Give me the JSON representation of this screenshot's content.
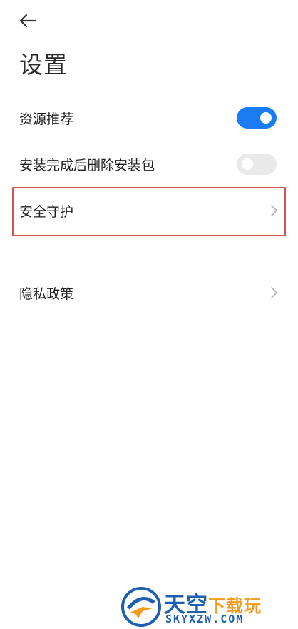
{
  "header": {
    "back_icon": "arrow-left-icon",
    "title": "设置"
  },
  "settings": {
    "resource_recommend": {
      "label": "资源推荐",
      "enabled": true
    },
    "delete_package": {
      "label": "安装完成后删除安装包",
      "enabled": false
    },
    "security": {
      "label": "安全守护",
      "icon": "chevron-right-icon"
    },
    "privacy": {
      "label": "隐私政策",
      "icon": "chevron-right-icon"
    }
  },
  "colors": {
    "toggle_on": "#1a7cf5",
    "toggle_off": "#e9e9e9",
    "highlight": "#d9534f"
  },
  "watermark": {
    "title_main": "天空",
    "title_accent": "下载玩",
    "subtitle": "SKYXZW.COM"
  }
}
